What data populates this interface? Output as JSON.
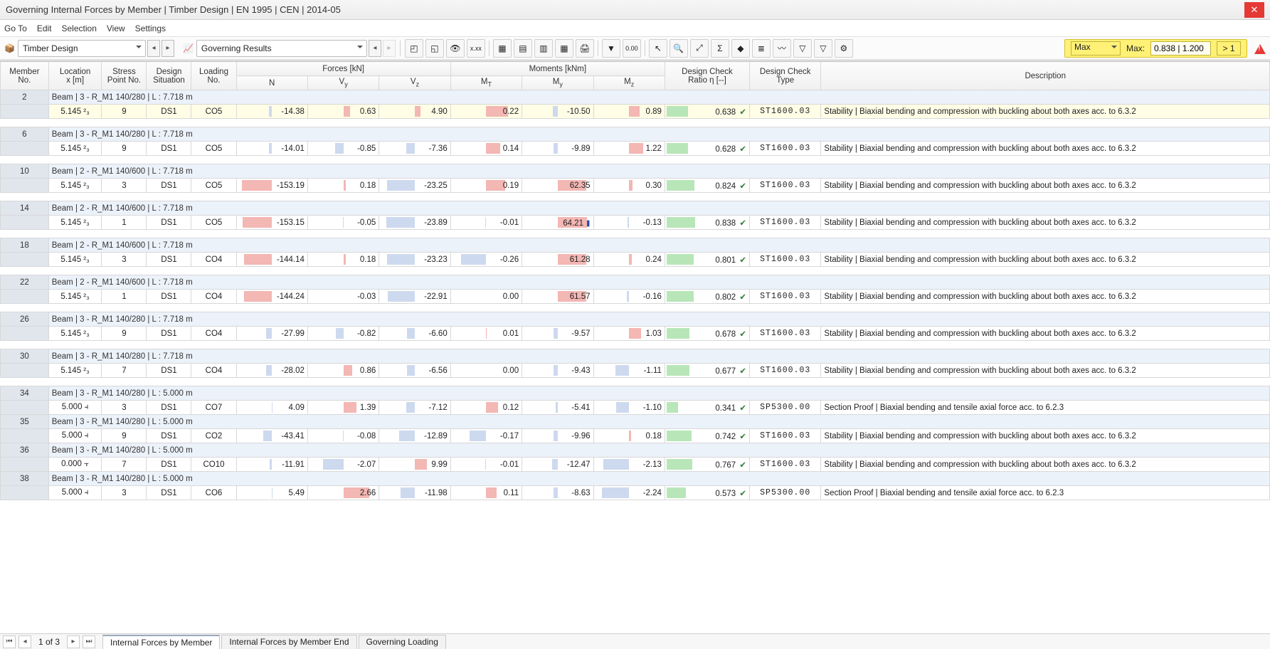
{
  "title": "Governing Internal Forces by Member | Timber Design | EN 1995 | CEN | 2014-05",
  "menu": [
    "Go To",
    "Edit",
    "Selection",
    "View",
    "Settings"
  ],
  "dropdowns": {
    "design": "Timber Design",
    "results": "Governing Results"
  },
  "toolbar_icons": [
    "select-window-icon",
    "select-crossing-icon",
    "eye-icon",
    "xxx-icon",
    "",
    "table-1-icon",
    "table-2-icon",
    "table-3-icon",
    "palette-icon",
    "print-icon",
    "",
    "filter-icon",
    "decimal-icon",
    "",
    "arrow-cursor-icon",
    "search-icon",
    "zoom-fit-icon",
    "sigma-icon",
    "colors-icon",
    "layers-icon",
    "wave-icon",
    "funnel-1-icon",
    "funnel-2-icon",
    "settings-icon"
  ],
  "toolbar_glyphs": {
    "select-window-icon": "◰",
    "select-crossing-icon": "◱",
    "eye-icon": "👁",
    "xxx-icon": "x.xx",
    "table-1-icon": "▦",
    "table-2-icon": "▤",
    "table-3-icon": "▥",
    "palette-icon": "▦",
    "print-icon": "🖨",
    "filter-icon": "▼",
    "decimal-icon": "0.00",
    "arrow-cursor-icon": "↖",
    "search-icon": "🔍",
    "zoom-fit-icon": "⤢",
    "sigma-icon": "Σ",
    "colors-icon": "◆",
    "layers-icon": "≣",
    "wave-icon": "〰",
    "funnel-1-icon": "▽",
    "funnel-2-icon": "▽",
    "settings-icon": "⚙"
  },
  "maxzone": {
    "mode": "Max",
    "label": "Max:",
    "value": "0.838 | 1.200",
    "gtone": "> 1"
  },
  "headers": {
    "memberno": "Member\nNo.",
    "location": "Location\nx [m]",
    "stresspt": "Stress\nPoint No.",
    "situation": "Design\nSituation",
    "loadno": "Loading\nNo.",
    "forces": "Forces [kN]",
    "moments": "Moments [kNm]",
    "N": "N",
    "Vy": "Vy",
    "Vz": "Vz",
    "MT": "MT",
    "My": "My",
    "Mz": "Mz",
    "ratio": "Design Check\nRatio η [--]",
    "type": "Design Check\nType",
    "desc": "Description"
  },
  "groups": [
    {
      "no": "2",
      "title": "Beam | 3 - R_M1 140/280 | L : 7.718 m",
      "hl": true,
      "row": {
        "loc": "5.145 ²₃",
        "sp": "9",
        "ds": "DS1",
        "ld": "CO5",
        "N": "-14.38",
        "Vy": "0.63",
        "Vz": "4.90",
        "MT": "0.22",
        "My": "-10.50",
        "Mz": "0.89",
        "eta": "0.638",
        "code": "ST1600.03",
        "desc": "Stability | Biaxial bending and compression with buckling about both axes acc. to 6.3.2"
      }
    },
    {
      "no": "6",
      "title": "Beam | 3 - R_M1 140/280 | L : 7.718 m",
      "row": {
        "loc": "5.145 ²₃",
        "sp": "9",
        "ds": "DS1",
        "ld": "CO5",
        "N": "-14.01",
        "Vy": "-0.85",
        "Vz": "-7.36",
        "MT": "0.14",
        "My": "-9.89",
        "Mz": "1.22",
        "eta": "0.628",
        "code": "ST1600.03",
        "desc": "Stability | Biaxial bending and compression with buckling about both axes acc. to 6.3.2"
      }
    },
    {
      "no": "10",
      "title": "Beam | 2 - R_M1 140/600 | L : 7.718 m",
      "row": {
        "loc": "5.145 ²₃",
        "sp": "3",
        "ds": "DS1",
        "ld": "CO5",
        "N": "-153.19",
        "Vy": "0.18",
        "Vz": "-23.25",
        "MT": "0.19",
        "My": "62.35",
        "Mz": "0.30",
        "eta": "0.824",
        "code": "ST1600.03",
        "desc": "Stability | Biaxial bending and compression with buckling about both axes acc. to 6.3.2"
      }
    },
    {
      "no": "14",
      "title": "Beam | 2 - R_M1 140/600 | L : 7.718 m",
      "row": {
        "loc": "5.145 ²₃",
        "sp": "1",
        "ds": "DS1",
        "ld": "CO5",
        "N": "-153.15",
        "Vy": "-0.05",
        "Vz": "-23.89",
        "MT": "-0.01",
        "My": "64.21",
        "Mz": "-0.13",
        "eta": "0.838",
        "code": "ST1600.03",
        "desc": "Stability | Biaxial bending and compression with buckling about both axes acc. to 6.3.2",
        "mymark": true
      }
    },
    {
      "no": "18",
      "title": "Beam | 2 - R_M1 140/600 | L : 7.718 m",
      "row": {
        "loc": "5.145 ²₃",
        "sp": "3",
        "ds": "DS1",
        "ld": "CO4",
        "N": "-144.14",
        "Vy": "0.18",
        "Vz": "-23.23",
        "MT": "-0.26",
        "My": "61.28",
        "Mz": "0.24",
        "eta": "0.801",
        "code": "ST1600.03",
        "desc": "Stability | Biaxial bending and compression with buckling about both axes acc. to 6.3.2"
      }
    },
    {
      "no": "22",
      "title": "Beam | 2 - R_M1 140/600 | L : 7.718 m",
      "row": {
        "loc": "5.145 ²₃",
        "sp": "1",
        "ds": "DS1",
        "ld": "CO4",
        "N": "-144.24",
        "Vy": "-0.03",
        "Vz": "-22.91",
        "MT": "0.00",
        "My": "61.57",
        "Mz": "-0.16",
        "eta": "0.802",
        "code": "ST1600.03",
        "desc": "Stability | Biaxial bending and compression with buckling about both axes acc. to 6.3.2"
      }
    },
    {
      "no": "26",
      "title": "Beam | 3 - R_M1 140/280 | L : 7.718 m",
      "row": {
        "loc": "5.145 ²₃",
        "sp": "9",
        "ds": "DS1",
        "ld": "CO4",
        "N": "-27.99",
        "Vy": "-0.82",
        "Vz": "-6.60",
        "MT": "0.01",
        "My": "-9.57",
        "Mz": "1.03",
        "eta": "0.678",
        "code": "ST1600.03",
        "desc": "Stability | Biaxial bending and compression with buckling about both axes acc. to 6.3.2"
      }
    },
    {
      "no": "30",
      "title": "Beam | 3 - R_M1 140/280 | L : 7.718 m",
      "row": {
        "loc": "5.145 ²₃",
        "sp": "7",
        "ds": "DS1",
        "ld": "CO4",
        "N": "-28.02",
        "Vy": "0.86",
        "Vz": "-6.56",
        "MT": "0.00",
        "My": "-9.43",
        "Mz": "-1.11",
        "eta": "0.677",
        "code": "ST1600.03",
        "desc": "Stability | Biaxial bending and compression with buckling about both axes acc. to 6.3.2"
      }
    },
    {
      "no": "34",
      "title": "Beam | 3 - R_M1 140/280 | L : 5.000 m",
      "row": {
        "loc": "5.000 ⫞",
        "sp": "3",
        "ds": "DS1",
        "ld": "CO7",
        "N": "4.09",
        "Vy": "1.39",
        "Vz": "-7.12",
        "MT": "0.12",
        "My": "-5.41",
        "Mz": "-1.10",
        "eta": "0.341",
        "code": "SP5300.00",
        "desc": "Section Proof | Biaxial bending and tensile axial force acc. to 6.2.3"
      }
    },
    {
      "no": "35",
      "title": "Beam | 3 - R_M1 140/280 | L : 5.000 m",
      "row": {
        "loc": "5.000 ⫞",
        "sp": "9",
        "ds": "DS1",
        "ld": "CO2",
        "N": "-43.41",
        "Vy": "-0.08",
        "Vz": "-12.89",
        "MT": "-0.17",
        "My": "-9.96",
        "Mz": "0.18",
        "eta": "0.742",
        "code": "ST1600.03",
        "desc": "Stability | Biaxial bending and compression with buckling about both axes acc. to 6.3.2"
      }
    },
    {
      "no": "36",
      "title": "Beam | 3 - R_M1 140/280 | L : 5.000 m",
      "row": {
        "loc": "0.000 ⫟",
        "sp": "7",
        "ds": "DS1",
        "ld": "CO10",
        "N": "-11.91",
        "Vy": "-2.07",
        "Vz": "9.99",
        "MT": "-0.01",
        "My": "-12.47",
        "Mz": "-2.13",
        "eta": "0.767",
        "code": "ST1600.03",
        "desc": "Stability | Biaxial bending and compression with buckling about both axes acc. to 6.3.2"
      }
    },
    {
      "no": "38",
      "title": "Beam | 3 - R_M1 140/280 | L : 5.000 m",
      "row": {
        "loc": "5.000 ⫞",
        "sp": "3",
        "ds": "DS1",
        "ld": "CO6",
        "N": "5.49",
        "Vy": "2.66",
        "Vz": "-11.98",
        "MT": "0.11",
        "My": "-8.63",
        "Mz": "-2.24",
        "eta": "0.573",
        "code": "SP5300.00",
        "desc": "Section Proof | Biaxial bending and tensile axial force acc. to 6.2.3"
      }
    }
  ],
  "footer": {
    "page": "1 of 3",
    "tabs": [
      "Internal Forces by Member",
      "Internal Forces by Member End",
      "Governing Loading"
    ],
    "active": 0
  }
}
